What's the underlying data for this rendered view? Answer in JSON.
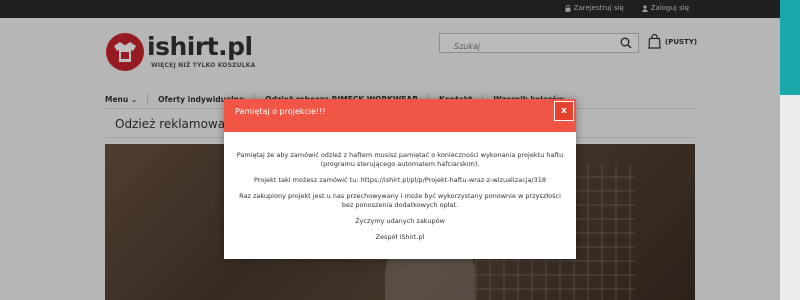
{
  "topbar": {
    "register_label": "Zarejestruj się",
    "login_label": "Zaloguj się"
  },
  "logo": {
    "name": "ishirt.pl",
    "tagline": "WIĘCEJ NIŻ TYLKO KOSZULKA"
  },
  "search": {
    "placeholder": "Szukaj"
  },
  "cart": {
    "label": "(PUSTY)"
  },
  "menu": {
    "items": [
      {
        "label": "Menu ⌄"
      },
      {
        "label": "Oferty indywidualne"
      },
      {
        "label": "Odzież robocza RIMECK WORKWEAR"
      },
      {
        "label": "Kontakt"
      },
      {
        "label": "Wzornik kolorów"
      }
    ]
  },
  "page": {
    "title": "Odzież reklamowa"
  },
  "modal": {
    "title": "Pamiętaj o projekcie!!!",
    "close_label": "x",
    "line1": "Pamiętaj że aby zamówić odzież z haftem musisz pamiętać o konieczności wykonania projektu haftu (programu sterującego automatem hafciarskim).",
    "line2": "Projekt taki możesz zamówić tu:   https://ishirt.pl/pl/p/Projekt-haftu-wraz-z-wizualizacja/318",
    "line3": "Raz zakupiony projekt jest u nas przechowywany i może być wykorzystany ponownie w przyszłości bez ponoszenia dodatkowych opłat.",
    "line4": "Życzymy udanych zakupów",
    "line5": "Zespół iShirt.pl"
  },
  "colors": {
    "modal_header": "#f05545",
    "accent_side": "#1ba7a9",
    "topbar": "#2b2b2b"
  }
}
